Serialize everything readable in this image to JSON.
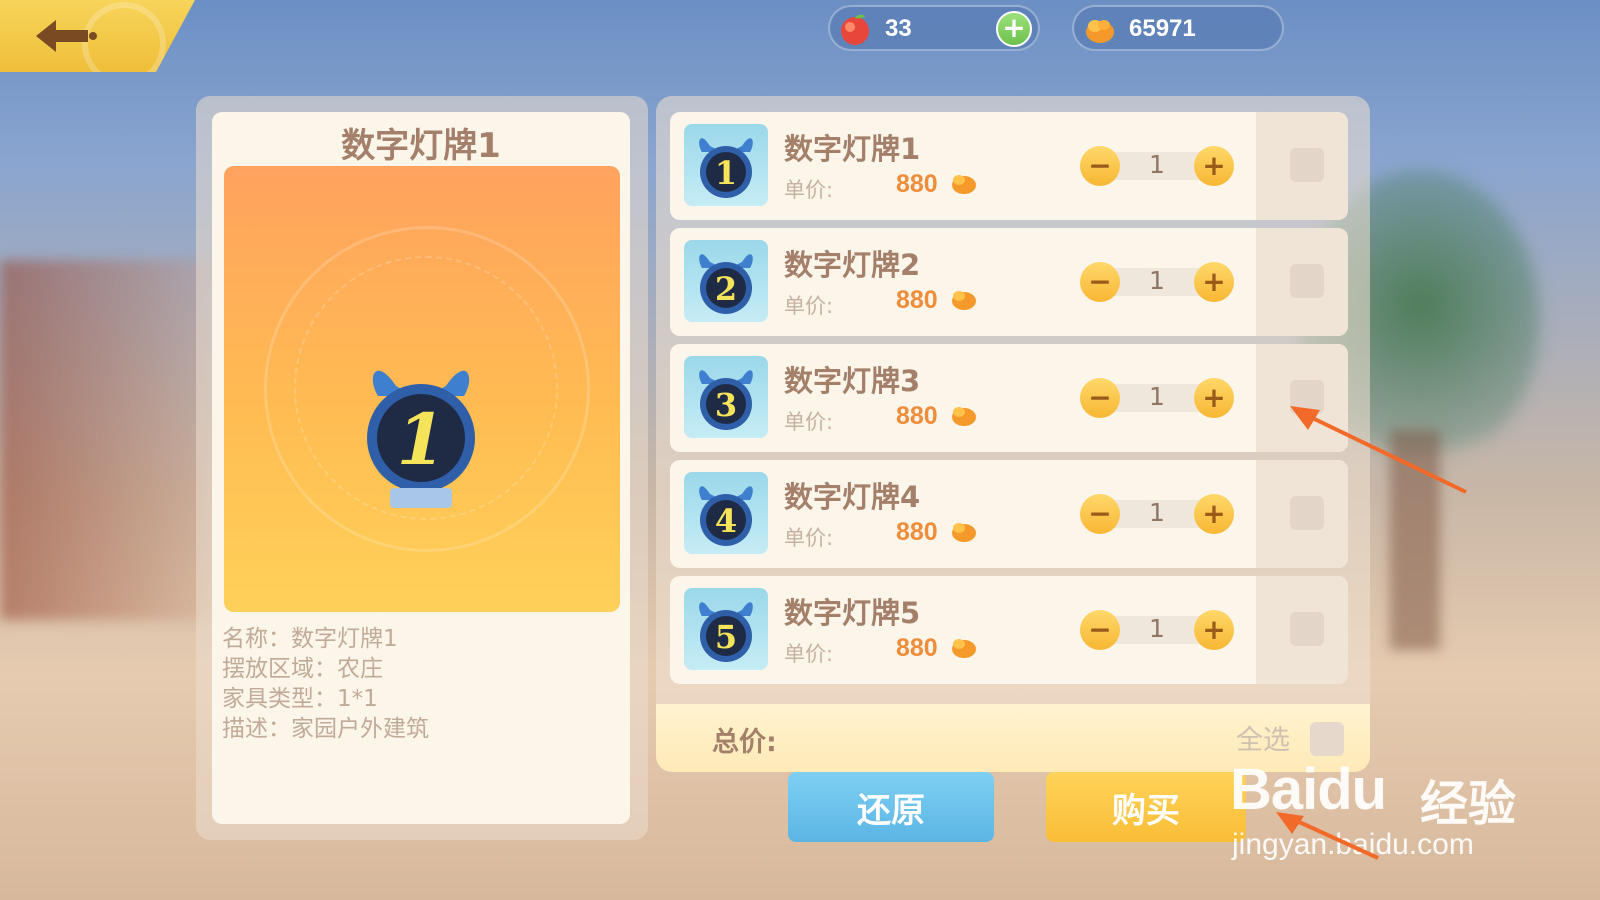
{
  "header": {
    "currency1": {
      "value": "33",
      "icon": "peach-icon"
    },
    "currency2": {
      "value": "65971",
      "icon": "coin-pouch-icon"
    }
  },
  "detail": {
    "title": "数字灯牌1",
    "info": [
      "名称：数字灯牌1",
      "摆放区域：农庄",
      "家具类型：1*1",
      "描述：家园户外建筑"
    ]
  },
  "items": [
    {
      "name": "数字灯牌1",
      "price_label": "单价:",
      "price": "880",
      "qty": "1",
      "num": "1"
    },
    {
      "name": "数字灯牌2",
      "price_label": "单价:",
      "price": "880",
      "qty": "1",
      "num": "2"
    },
    {
      "name": "数字灯牌3",
      "price_label": "单价:",
      "price": "880",
      "qty": "1",
      "num": "3"
    },
    {
      "name": "数字灯牌4",
      "price_label": "单价:",
      "price": "880",
      "qty": "1",
      "num": "4"
    },
    {
      "name": "数字灯牌5",
      "price_label": "单价:",
      "price": "880",
      "qty": "1",
      "num": "5"
    }
  ],
  "footer": {
    "total_label": "总价:",
    "select_all_label": "全选",
    "restore_label": "还原",
    "buy_label": "购买"
  },
  "watermark": {
    "logo": "Baidu",
    "cn": "经验",
    "url": "jingyan.baidu.com"
  },
  "colors": {
    "accent_orange": "#ef8e3a",
    "restore_blue": "#5bb5e4",
    "buy_yellow": "#f9bd36",
    "annotation_arrow": "#f26a2a"
  }
}
